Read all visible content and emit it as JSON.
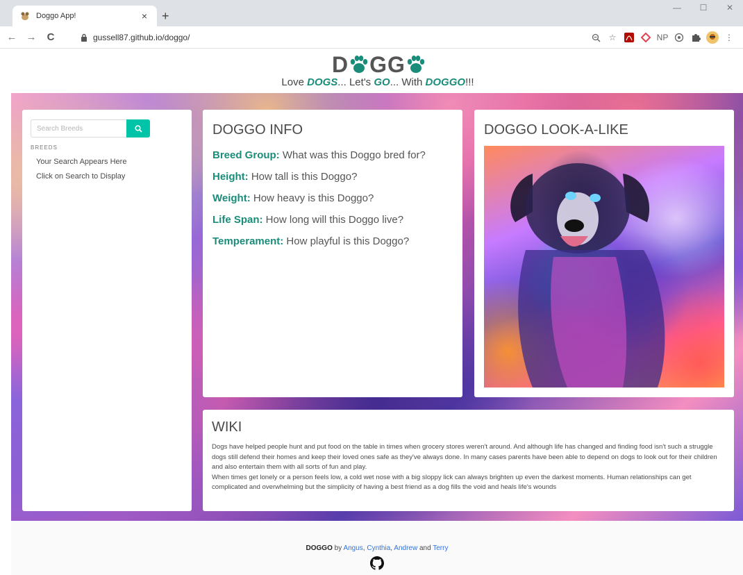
{
  "browser": {
    "tab_title": "Doggo App!",
    "tab_close": "×",
    "new_tab": "+",
    "url": "gussell87.github.io/doggo/",
    "win_min": "—",
    "win_max": "☐",
    "win_close": "✕",
    "ext_np": "NP"
  },
  "header": {
    "logo_d": "D",
    "logo_gg": "GG",
    "tagline": {
      "love": "Love ",
      "dogs": "DOGS",
      "lets": "... Let's ",
      "go": "GO",
      "with": "... With ",
      "doggo": "DOGGO",
      "end": "!!!"
    }
  },
  "sidebar": {
    "search_placeholder": "Search Breeds",
    "breeds_label": "BREEDS",
    "items": [
      "Your Search Appears Here",
      "Click on Search to Display"
    ]
  },
  "info": {
    "title": "DOGGO INFO",
    "rows": [
      {
        "key": "Breed Group:",
        "value": " What was this Doggo bred for?"
      },
      {
        "key": "Height:",
        "value": " How tall is this Doggo?"
      },
      {
        "key": "Weight:",
        "value": " How heavy is this Doggo?"
      },
      {
        "key": "Life Span:",
        "value": " How long will this Doggo live?"
      },
      {
        "key": "Temperament:",
        "value": " How playful is this Doggo?"
      }
    ]
  },
  "lookalike": {
    "title": "DOGGO LOOK-A-LIKE"
  },
  "wiki": {
    "title": "WIKI",
    "p1": "Dogs have helped people hunt and put food on the table in times when grocery stores weren't around. And although life has changed and finding food isn't such a struggle dogs still defend their homes and keep their loved ones safe as they've always done. In many cases parents have been able to depend on dogs to look out for their children and also entertain them with all sorts of fun and play.",
    "p2": "When times get lonely or a person feels low, a cold wet nose with a big sloppy lick can always brighten up even the darkest moments. Human relationships can get complicated and overwhelming but the simplicity of having a best friend as a dog fills the void and heals life's wounds"
  },
  "footer": {
    "brand": "DOGGO",
    "by": " by ",
    "authors": [
      "Angus",
      "Cynthia",
      "Andrew",
      "Terry"
    ],
    "sep1": ", ",
    "sep2": ", ",
    "and": " and "
  },
  "colors": {
    "accent": "#1a8c7a",
    "search_button": "#00c4a7",
    "link": "#3273dc"
  }
}
